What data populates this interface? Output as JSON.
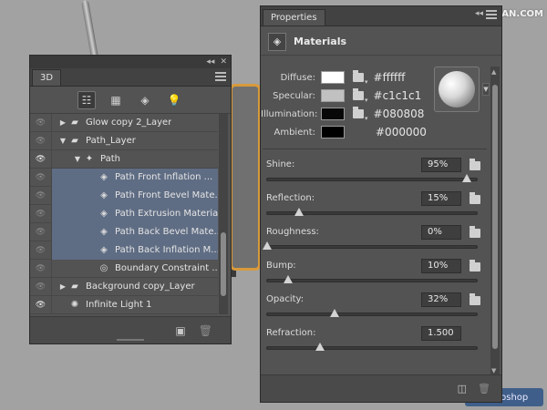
{
  "watermark": {
    "top": "思缘设计论坛 WWW.MISSYUAN.COM",
    "bottom": "Photoshop"
  },
  "panel_3d": {
    "tab_label": "3D",
    "topbar_collapse": "◂◂",
    "topbar_close": "✕",
    "filter_icons": [
      "scene-filter-icon",
      "mesh-filter-icon",
      "material-filter-icon",
      "light-filter-icon"
    ],
    "layers": [
      {
        "name": "Glow copy 2_Layer",
        "eye": false,
        "twirl": "▶",
        "icon": "▰",
        "indent": 0,
        "selected": false
      },
      {
        "name": "Path_Layer",
        "eye": false,
        "twirl": "▼",
        "icon": "▰",
        "indent": 0,
        "selected": false
      },
      {
        "name": "Path",
        "eye": true,
        "twirl": "▼",
        "icon": "✦",
        "indent": 1,
        "selected": false
      },
      {
        "name": "Path Front Inflation ...",
        "eye": false,
        "twirl": "",
        "icon": "◈",
        "indent": 2,
        "selected": true
      },
      {
        "name": "Path Front Bevel Mate...",
        "eye": false,
        "twirl": "",
        "icon": "◈",
        "indent": 2,
        "selected": true
      },
      {
        "name": "Path Extrusion Material",
        "eye": false,
        "twirl": "",
        "icon": "◈",
        "indent": 2,
        "selected": true
      },
      {
        "name": "Path Back Bevel Mate...",
        "eye": false,
        "twirl": "",
        "icon": "◈",
        "indent": 2,
        "selected": true
      },
      {
        "name": "Path Back Inflation M...",
        "eye": false,
        "twirl": "",
        "icon": "◈",
        "indent": 2,
        "selected": true
      },
      {
        "name": "Boundary Constraint ...",
        "eye": false,
        "twirl": "",
        "icon": "◎",
        "indent": 2,
        "selected": false
      },
      {
        "name": "Background copy_Layer",
        "eye": false,
        "twirl": "▶",
        "icon": "▰",
        "indent": 0,
        "selected": false
      },
      {
        "name": "Infinite Light 1",
        "eye": true,
        "twirl": "",
        "icon": "✺",
        "indent": 0,
        "selected": false
      }
    ],
    "footer_new": "▣",
    "footer_trash": "🗑"
  },
  "properties": {
    "tab_label": "Properties",
    "topbar_collapse": "◂◂",
    "topbar_close": "✕",
    "header_title": "Materials",
    "colors": [
      {
        "label": "Diffuse:",
        "swatch": "#ffffff",
        "hex": "#ffffff",
        "has_folder": true
      },
      {
        "label": "Specular:",
        "swatch": "#c1c1c1",
        "hex": "#c1c1c1",
        "has_folder": true
      },
      {
        "label": "Illumination:",
        "swatch": "#080808",
        "hex": "#080808",
        "has_folder": true
      },
      {
        "label": "Ambient:",
        "swatch": "#000000",
        "hex": "#000000",
        "has_folder": false
      }
    ],
    "sliders": [
      {
        "label": "Shine:",
        "value": "95%",
        "position": 0.95,
        "has_folder": true
      },
      {
        "label": "Reflection:",
        "value": "15%",
        "position": 0.15,
        "has_folder": true
      },
      {
        "label": "Roughness:",
        "value": "0%",
        "position": 0.0,
        "has_folder": true
      },
      {
        "label": "Bump:",
        "value": "10%",
        "position": 0.1,
        "has_folder": true
      },
      {
        "label": "Opacity:",
        "value": "32%",
        "position": 0.32,
        "has_folder": true
      },
      {
        "label": "Refraction:",
        "value": "1.500",
        "position": 0.25,
        "has_folder": false
      }
    ],
    "footer_btn": "◫",
    "footer_trash": "🗑"
  }
}
